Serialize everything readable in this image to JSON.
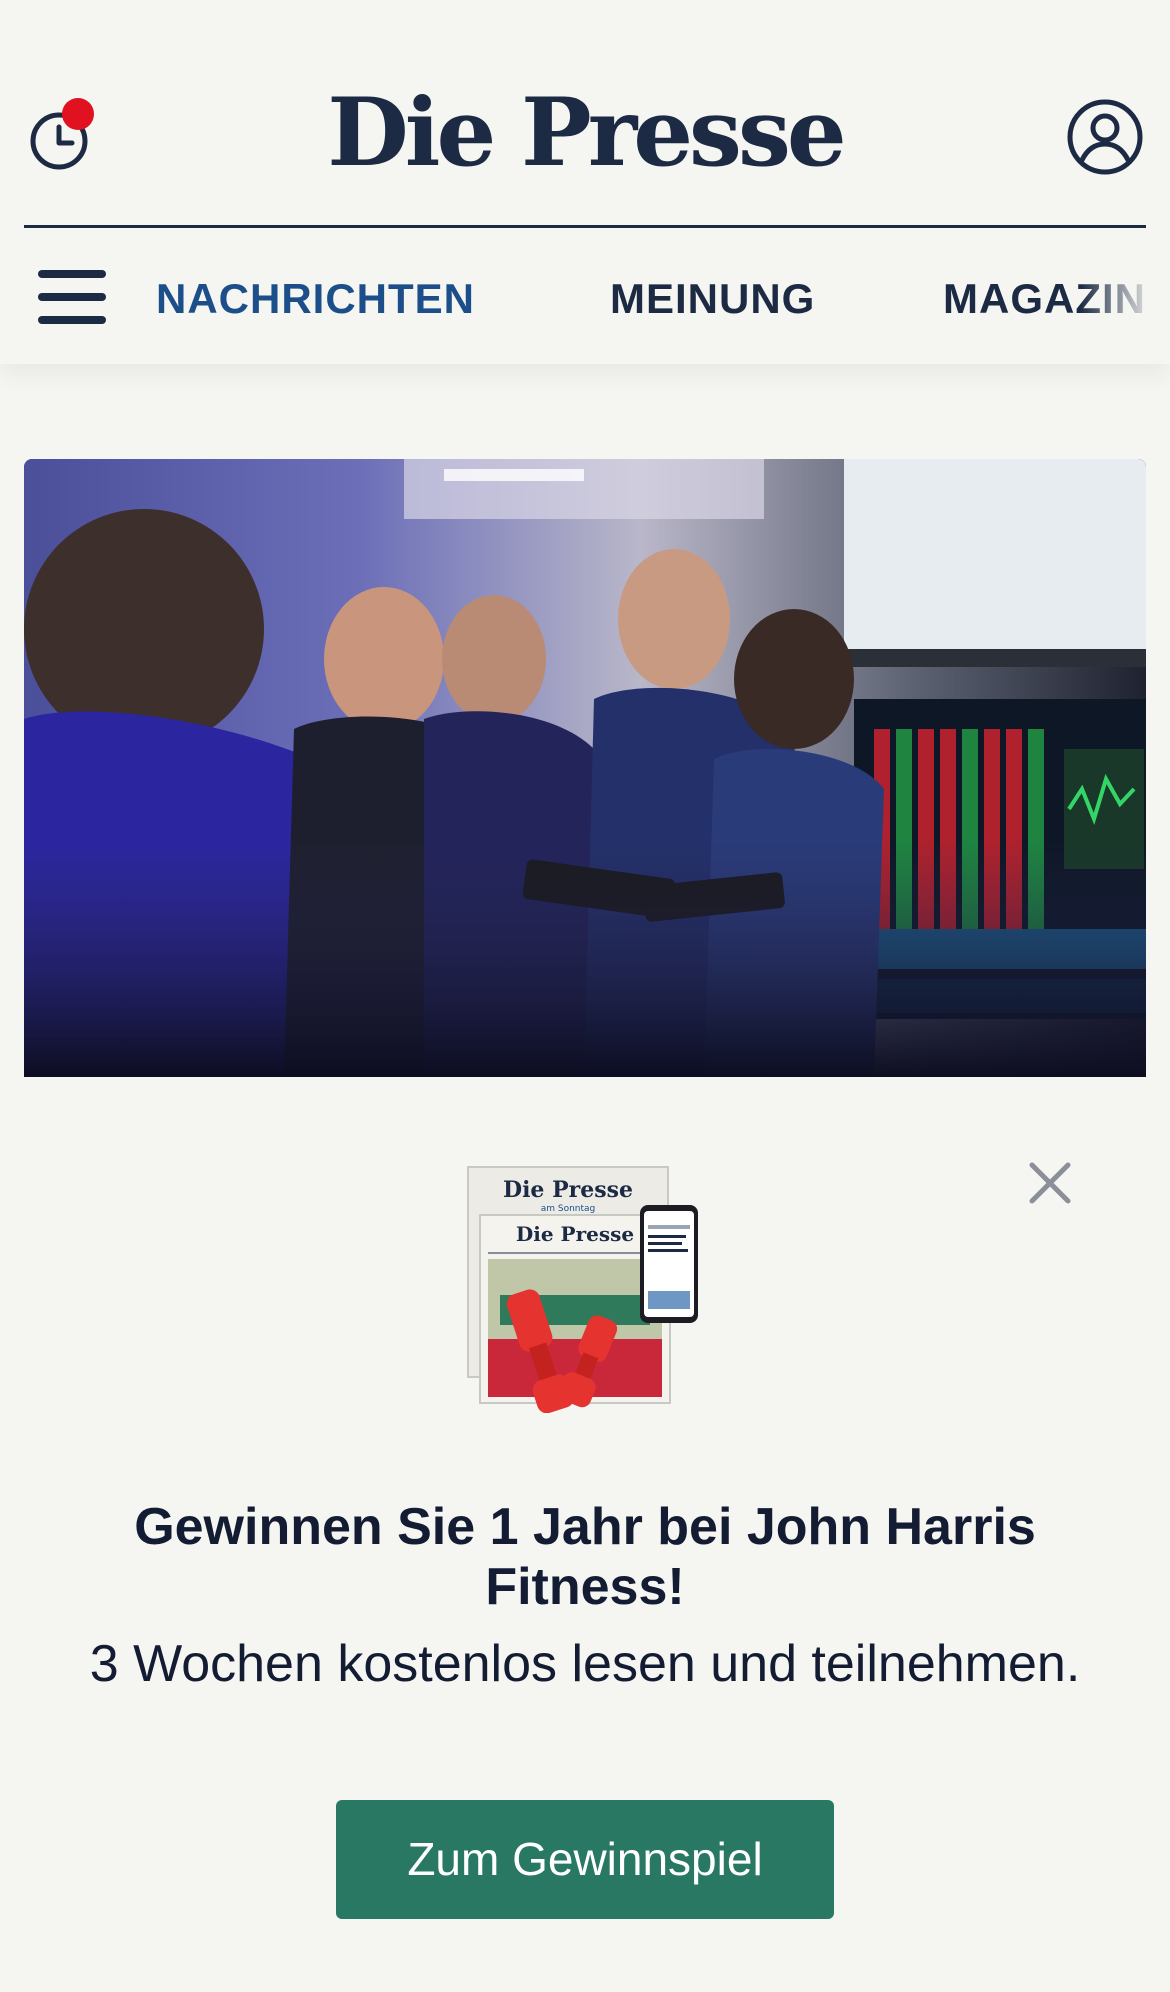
{
  "header": {
    "logo_text": "Die Presse",
    "history_icon": "clock-history-icon",
    "account_icon": "user-account-icon",
    "notification_color": "#e1121f"
  },
  "nav": {
    "menu_icon": "hamburger-menu-icon",
    "items": [
      {
        "label": "NACHRICHTEN",
        "active": true
      },
      {
        "label": "MEINUNG",
        "active": false
      },
      {
        "label": "MAGAZIN",
        "active": false
      }
    ],
    "active_color": "#1c4f8a",
    "text_color": "#1c2a44"
  },
  "hero": {
    "image_subject": "stock-exchange-traders-photo"
  },
  "promo": {
    "close_icon": "close-icon",
    "image_subject": "newspaper-dumbbells-phone-promo-image",
    "newspaper_title_1": "Die Presse",
    "newspaper_subtitle_1": "am Sonntag",
    "newspaper_title_2": "Die Presse",
    "title": "Gewinnen Sie 1 Jahr bei John Harris Fitness!",
    "subtitle": "3 Wochen kostenlos lesen und teilnehmen.",
    "cta_label": "Zum Gewinnspiel",
    "cta_color": "#287864"
  },
  "colors": {
    "background": "#f5f5f1",
    "brand_navy": "#1c2a44"
  }
}
